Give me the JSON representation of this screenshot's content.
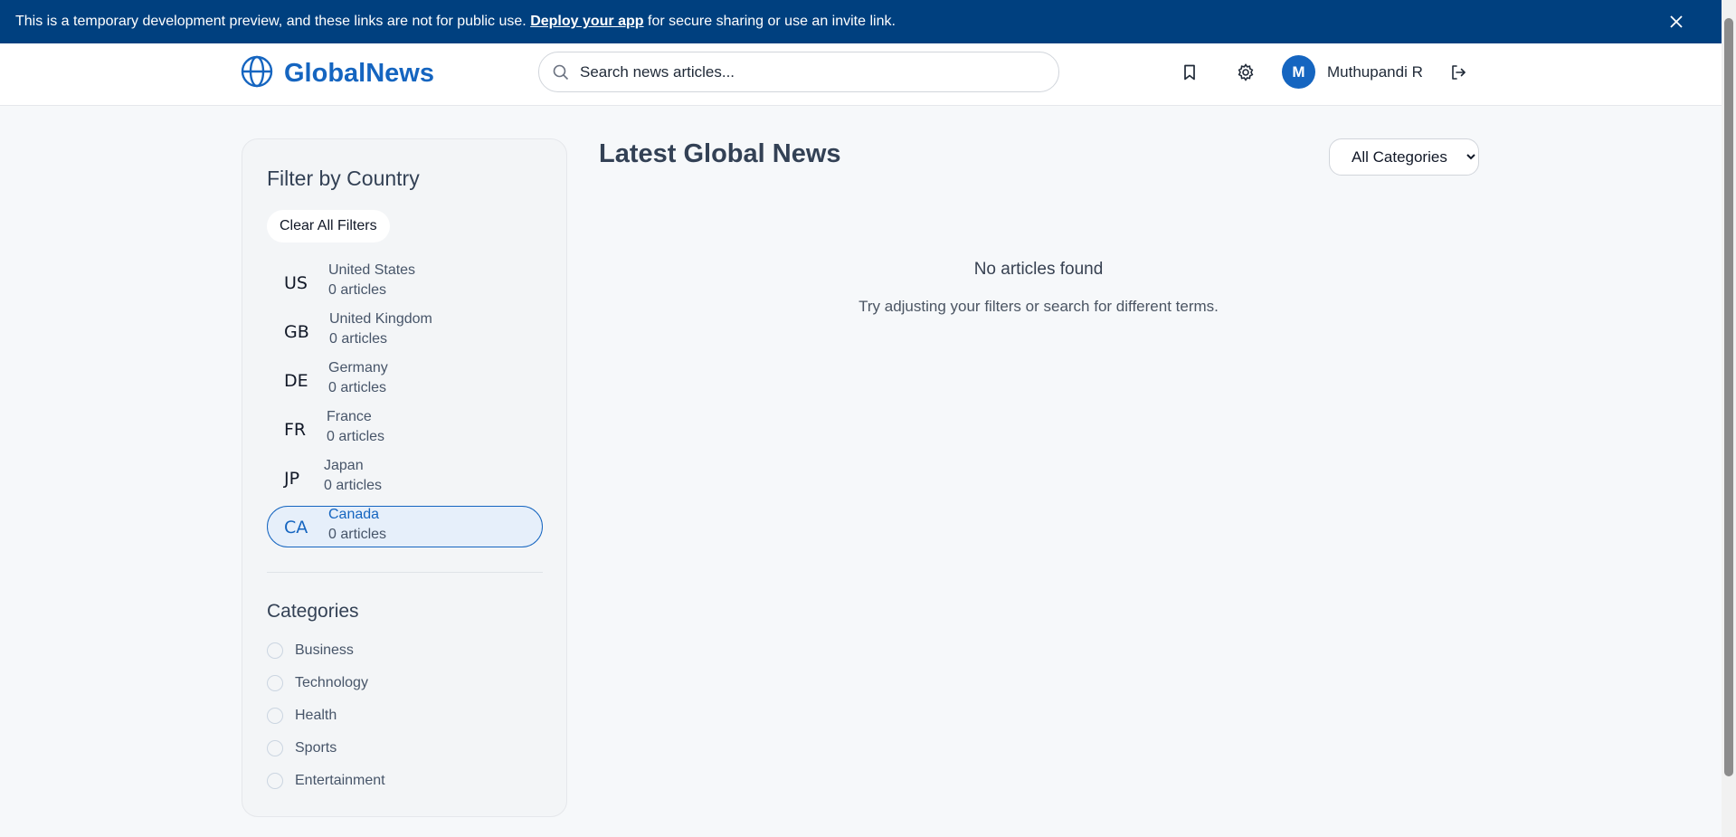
{
  "banner": {
    "text_before": "This is a temporary development preview, and these links are not for public use.",
    "link_text": "Deploy your app",
    "text_after": "for secure sharing or use an invite link.",
    "close_icon": "close-icon"
  },
  "header": {
    "brand": "GlobalNews",
    "logo_icon": "globe-icon",
    "search_placeholder": "Search news articles...",
    "user_initial": "M",
    "user_name": "Muthupandi R",
    "icons": [
      "bookmark-icon",
      "gear-icon",
      "logout-icon"
    ]
  },
  "sidebar": {
    "title": "Filter by Country",
    "clear_label": "Clear All Filters",
    "countries": [
      {
        "code": "US",
        "name": "United States",
        "count": "0 articles",
        "active": false
      },
      {
        "code": "GB",
        "name": "United Kingdom",
        "count": "0 articles",
        "active": false
      },
      {
        "code": "DE",
        "name": "Germany",
        "count": "0 articles",
        "active": false
      },
      {
        "code": "FR",
        "name": "France",
        "count": "0 articles",
        "active": false
      },
      {
        "code": "JP",
        "name": "Japan",
        "count": "0 articles",
        "active": false
      },
      {
        "code": "CA",
        "name": "Canada",
        "count": "0 articles",
        "active": true
      }
    ],
    "categories_title": "Categories",
    "categories": [
      "Business",
      "Technology",
      "Health",
      "Sports",
      "Entertainment"
    ]
  },
  "main": {
    "title": "Latest Global News",
    "category_select": "All Categories",
    "empty_title": "No articles found",
    "empty_subtitle": "Try adjusting your filters or search for different terms."
  },
  "colors": {
    "banner_bg": "#00407f",
    "brand": "#1565c0",
    "page_bg": "#f6f8fa"
  }
}
